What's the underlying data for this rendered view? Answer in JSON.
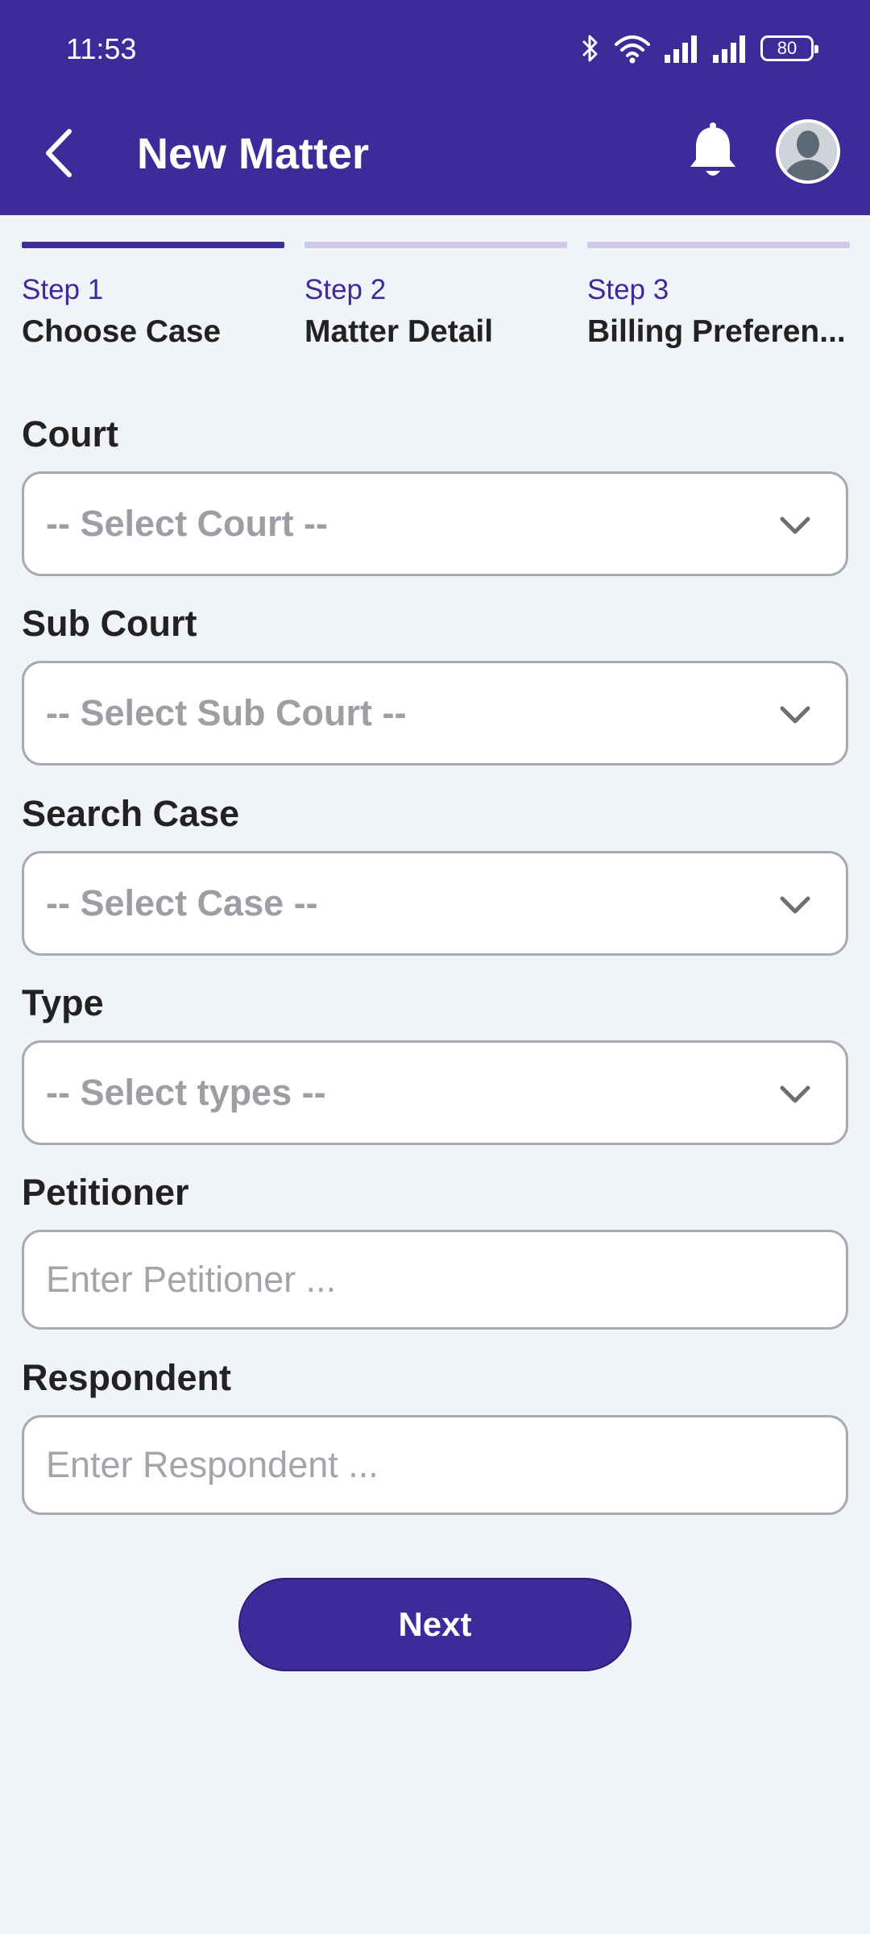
{
  "status_bar": {
    "time": "11:53",
    "battery": "80"
  },
  "header": {
    "title": "New Matter"
  },
  "steps": [
    {
      "number": "Step 1",
      "name": "Choose Case",
      "active": true
    },
    {
      "number": "Step 2",
      "name": "Matter Detail",
      "active": false
    },
    {
      "number": "Step 3",
      "name": "Billing Preferen...",
      "active": false
    }
  ],
  "form": {
    "court": {
      "label": "Court",
      "placeholder": "-- Select Court --"
    },
    "sub_court": {
      "label": "Sub Court",
      "placeholder": "-- Select Sub Court --"
    },
    "search_case": {
      "label": "Search Case",
      "placeholder": "-- Select Case --"
    },
    "type": {
      "label": "Type",
      "placeholder": "-- Select types --"
    },
    "petitioner": {
      "label": "Petitioner",
      "placeholder": "Enter Petitioner ..."
    },
    "respondent": {
      "label": "Respondent",
      "placeholder": "Enter Respondent ..."
    }
  },
  "actions": {
    "next_label": "Next"
  },
  "colors": {
    "primary": "#3f2a99",
    "background": "#f0f3f8",
    "step_inactive": "#cfc8e6"
  }
}
